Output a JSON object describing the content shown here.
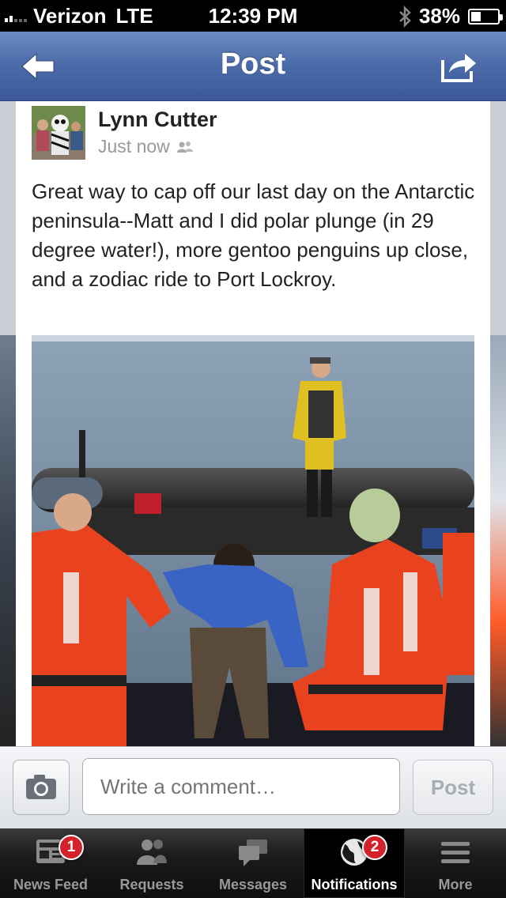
{
  "status_bar": {
    "carrier": "Verizon",
    "network": "LTE",
    "time": "12:39 PM",
    "battery": "38%",
    "battery_level": 0.38
  },
  "nav": {
    "title": "Post",
    "back_icon": "back-arrow-icon",
    "share_icon": "share-icon"
  },
  "post": {
    "author": "Lynn Cutter",
    "timestamp": "Just now",
    "privacy_icon": "friends-icon",
    "text": "Great way to cap off our last day on the Antarctic peninsula--Matt and I did polar plunge (in 29 degree water!), more gentoo penguins up close, and a zodiac ride to Port Lockroy."
  },
  "comment_bar": {
    "camera_icon": "camera-icon",
    "placeholder": "Write a comment…",
    "post_label": "Post"
  },
  "tabs": [
    {
      "label": "News Feed",
      "icon": "news-feed-icon",
      "badge": "1"
    },
    {
      "label": "Requests",
      "icon": "requests-icon",
      "badge": ""
    },
    {
      "label": "Messages",
      "icon": "messages-icon",
      "badge": ""
    },
    {
      "label": "Notifications",
      "icon": "globe-icon",
      "badge": "2",
      "active": true
    },
    {
      "label": "More",
      "icon": "menu-icon",
      "badge": ""
    }
  ],
  "colors": {
    "nav": "#3b5998",
    "badge": "#d4222a"
  }
}
